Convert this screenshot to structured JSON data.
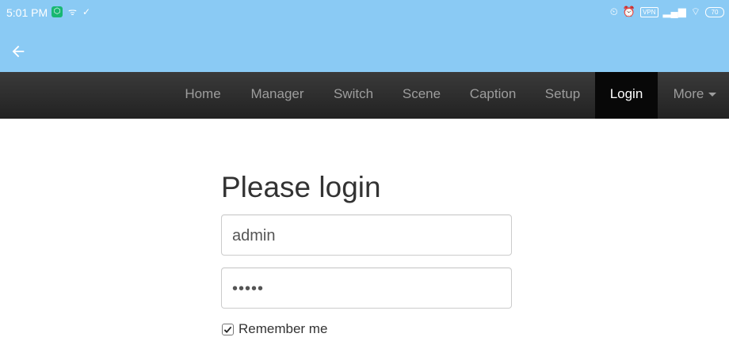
{
  "status_bar": {
    "time": "5:01 PM",
    "left_icons": [
      "app-badge-icon",
      "wifi-small-icon",
      "check-mark-icon"
    ],
    "right_icons": [
      "alarm-off-icon",
      "alarm-icon",
      "vpn-icon",
      "signal-icon",
      "wifi-icon",
      "battery-icon"
    ],
    "vpn_label": "VPN",
    "battery_level": "70"
  },
  "app_bar": {
    "back_icon": "arrow-left-icon"
  },
  "navbar": {
    "items": [
      {
        "label": "Home"
      },
      {
        "label": "Manager"
      },
      {
        "label": "Switch"
      },
      {
        "label": "Scene"
      },
      {
        "label": "Caption"
      },
      {
        "label": "Setup"
      },
      {
        "label": "Login",
        "active": true
      },
      {
        "label": "More",
        "dropdown": true
      }
    ]
  },
  "login": {
    "title": "Please login",
    "username_value": "admin",
    "password_masked": "•••••",
    "remember_label": "Remember me",
    "remember_checked": true
  },
  "colors": {
    "top_bar": "#8acaf4",
    "navbar": "#222222",
    "nav_active": "#080808",
    "nav_text": "#9d9d9d"
  }
}
